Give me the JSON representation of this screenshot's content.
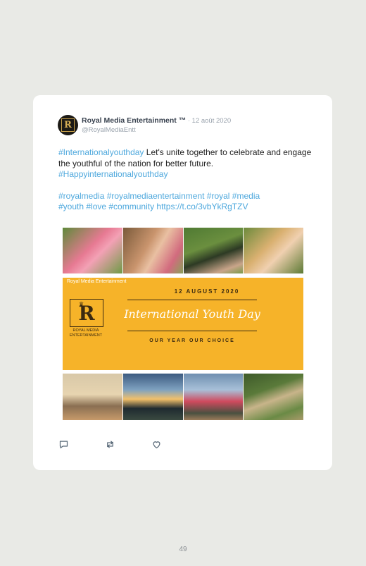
{
  "tweet": {
    "author_name": "Royal Media Entertainment ™",
    "separator": " · ",
    "date": "12 août 2020",
    "handle": "@RoyalMediaEntt",
    "avatar_letter": "R",
    "hashtag_lead": "#Internationalyouthday",
    "text_1": " Let's unite together to celebrate and engage the youthful of the nation for better future.",
    "hashtag_2": "#Happyinternationalyouthday",
    "hashtags_line_1": "#royalmedia #royalmediaentertainment #royal #media",
    "hashtags_line_2": "#youth #love #community",
    "link": "https://t.co/3vbYkRgTZV"
  },
  "banner": {
    "top_label": "Royal Media Entertainment",
    "date": "12 AUGUST 2020",
    "title": "International Youth Day",
    "slogan": "OUR YEAR OUR CHOICE",
    "logo_letter": "R",
    "logo_text": "ROYAL MEDIA ENTERTAINMENT"
  },
  "actions": [
    {
      "icon": "reply-icon"
    },
    {
      "icon": "retweet-icon"
    },
    {
      "icon": "like-icon"
    }
  ],
  "page_number": "49",
  "colors": {
    "background": "#e9eae6",
    "card": "#ffffff",
    "link_blue": "#4ea8dd",
    "banner_yellow": "#f6b329"
  }
}
